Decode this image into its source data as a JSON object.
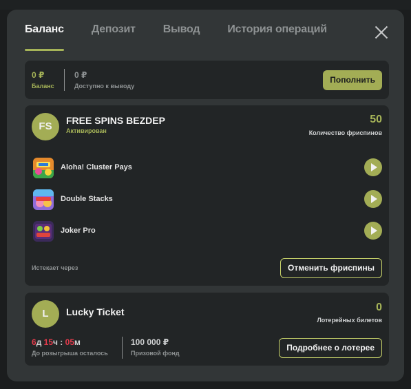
{
  "tabs": [
    {
      "label": "Баланс",
      "active": true
    },
    {
      "label": "Депозит",
      "active": false
    },
    {
      "label": "Вывод",
      "active": false
    },
    {
      "label": "История операций",
      "active": false
    }
  ],
  "balance": {
    "balance_value": "0 ₽",
    "balance_label": "Баланс",
    "withdrawable_value": "0 ₽",
    "withdrawable_label": "Доступно к выводу",
    "topup_label": "Пополнить"
  },
  "freespins": {
    "avatar_text": "FS",
    "title": "FREE SPINS BEZDEP",
    "status": "Активирован",
    "count": "50",
    "count_label": "Количество фриспинов",
    "games": [
      {
        "name": "Aloha! Cluster Pays"
      },
      {
        "name": "Double Stacks"
      },
      {
        "name": "Joker Pro"
      }
    ],
    "expires_label": "Истекает через",
    "cancel_label": "Отменить фриспины"
  },
  "lottery": {
    "avatar_text": "L",
    "title": "Lucky Ticket",
    "count": "0",
    "count_label": "Лотерейных билетов",
    "timer": {
      "days": "6",
      "d": "д ",
      "hours": "15",
      "h": "ч : ",
      "minutes": "05",
      "m": "м"
    },
    "timer_label": "До розыгрыша осталось",
    "prize_value": "100 000 ₽",
    "prize_label": "Призовой фонд",
    "details_label": "Подробнее о лотерее"
  },
  "colors": {
    "accent": "#a3ad55",
    "timer_red": "#e23b4c",
    "modal_bg": "#323637",
    "card_bg": "#222526"
  },
  "icons": {
    "close": "close-icon",
    "play": "play-icon"
  }
}
